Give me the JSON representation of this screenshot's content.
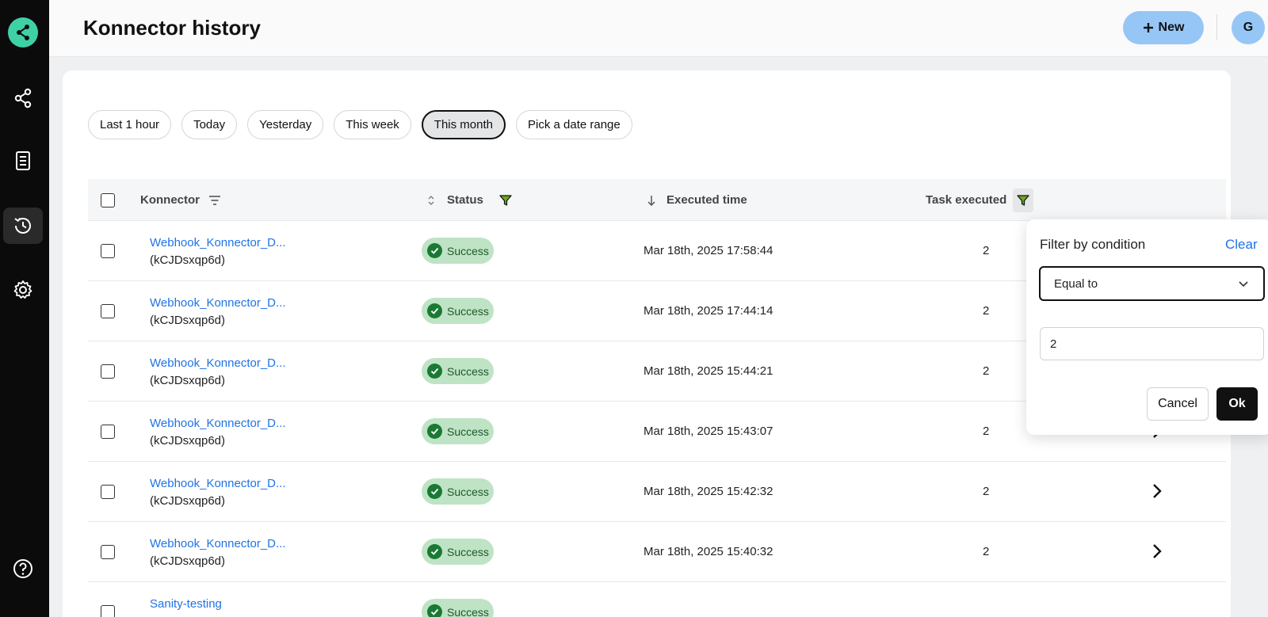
{
  "header": {
    "title": "Konnector history",
    "new_button_label": "New",
    "avatar_initial": "G"
  },
  "sidebar": {
    "items": [
      {
        "name": "konnectors",
        "icon": "share-nodes-icon"
      },
      {
        "name": "templates",
        "icon": "document-icon"
      },
      {
        "name": "history",
        "icon": "history-icon",
        "active": true
      },
      {
        "name": "settings",
        "icon": "gear-icon"
      },
      {
        "name": "help",
        "icon": "help-circle-icon"
      }
    ]
  },
  "date_filters": {
    "chips": [
      "Last 1 hour",
      "Today",
      "Yesterday",
      "This week",
      "This month",
      "Pick a date range"
    ],
    "selected": "This month"
  },
  "table": {
    "columns": {
      "konnector": "Konnector",
      "status": "Status",
      "executed_time": "Executed time",
      "task_executed": "Task executed"
    },
    "rows": [
      {
        "name": "Webhook_Konnector_D...",
        "id": "(kCJDsxqp6d)",
        "status": "Success",
        "executed_time": "Mar 18th, 2025 17:58:44",
        "tasks": "2"
      },
      {
        "name": "Webhook_Konnector_D...",
        "id": "(kCJDsxqp6d)",
        "status": "Success",
        "executed_time": "Mar 18th, 2025 17:44:14",
        "tasks": "2"
      },
      {
        "name": "Webhook_Konnector_D...",
        "id": "(kCJDsxqp6d)",
        "status": "Success",
        "executed_time": "Mar 18th, 2025 15:44:21",
        "tasks": "2"
      },
      {
        "name": "Webhook_Konnector_D...",
        "id": "(kCJDsxqp6d)",
        "status": "Success",
        "executed_time": "Mar 18th, 2025 15:43:07",
        "tasks": "2"
      },
      {
        "name": "Webhook_Konnector_D...",
        "id": "(kCJDsxqp6d)",
        "status": "Success",
        "executed_time": "Mar 18th, 2025 15:42:32",
        "tasks": "2"
      },
      {
        "name": "Webhook_Konnector_D...",
        "id": "(kCJDsxqp6d)",
        "status": "Success",
        "executed_time": "Mar 18th, 2025 15:40:32",
        "tasks": "2"
      },
      {
        "name": "Sanity-testing",
        "id": "",
        "status": "Success",
        "executed_time": "",
        "tasks": ""
      }
    ]
  },
  "filter_popover": {
    "title": "Filter by condition",
    "clear_label": "Clear",
    "condition_value": "Equal to",
    "input_value": "2",
    "cancel_label": "Cancel",
    "ok_label": "Ok"
  },
  "colors": {
    "accent_blue": "#96c6f6",
    "link_blue": "#1f73e6",
    "success_bg": "#bfe3c5",
    "success_icon": "#1a7a34",
    "filter_icon": "#6aa81e",
    "logo": "#3fd1a6"
  }
}
